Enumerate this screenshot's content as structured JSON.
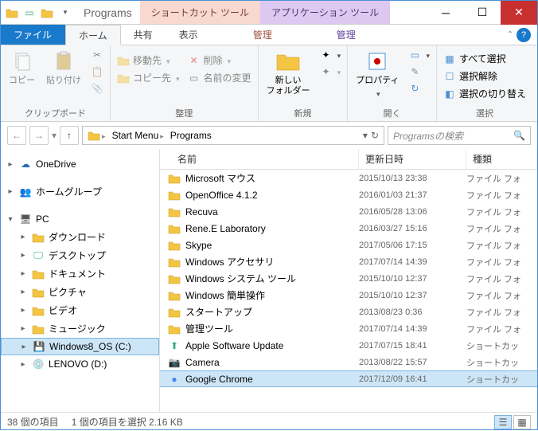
{
  "window": {
    "title": "Programs",
    "context_tabs": [
      "ショートカット ツール",
      "アプリケーション ツール"
    ]
  },
  "tabs": {
    "file": "ファイル",
    "home": "ホーム",
    "share": "共有",
    "view": "表示",
    "ctx1": "管理",
    "ctx2": "管理"
  },
  "ribbon": {
    "clipboard": {
      "label": "クリップボード",
      "copy": "コピー",
      "paste": "貼り付け"
    },
    "organize": {
      "label": "整理",
      "move_to": "移動先",
      "copy_to": "コピー先",
      "delete": "削除",
      "rename": "名前の変更"
    },
    "new": {
      "label": "新規",
      "new_folder": "新しい\nフォルダー"
    },
    "open": {
      "label": "開く",
      "properties": "プロパティ"
    },
    "select": {
      "label": "選択",
      "select_all": "すべて選択",
      "select_none": "選択解除",
      "invert": "選択の切り替え"
    }
  },
  "breadcrumb": {
    "items": [
      "Start Menu",
      "Programs"
    ]
  },
  "search": {
    "placeholder": "Programsの検索"
  },
  "sidebar": {
    "onedrive": "OneDrive",
    "homegroup": "ホームグループ",
    "pc": "PC",
    "downloads": "ダウンロード",
    "desktop": "デスクトップ",
    "documents": "ドキュメント",
    "pictures": "ピクチャ",
    "videos": "ビデオ",
    "music": "ミュージック",
    "drive_c": "Windows8_OS (C:)",
    "drive_d": "LENOVO (D:)"
  },
  "columns": {
    "name": "名前",
    "date": "更新日時",
    "type": "種類"
  },
  "files": [
    {
      "name": "Microsoft マウス",
      "date": "2015/10/13 23:38",
      "type": "ファイル フォ",
      "icon": "folder"
    },
    {
      "name": "OpenOffice 4.1.2",
      "date": "2016/01/03 21:37",
      "type": "ファイル フォ",
      "icon": "folder"
    },
    {
      "name": "Recuva",
      "date": "2016/05/28 13:06",
      "type": "ファイル フォ",
      "icon": "folder"
    },
    {
      "name": "Rene.E Laboratory",
      "date": "2016/03/27 15:16",
      "type": "ファイル フォ",
      "icon": "folder"
    },
    {
      "name": "Skype",
      "date": "2017/05/06 17:15",
      "type": "ファイル フォ",
      "icon": "folder"
    },
    {
      "name": "Windows アクセサリ",
      "date": "2017/07/14 14:39",
      "type": "ファイル フォ",
      "icon": "folder"
    },
    {
      "name": "Windows システム ツール",
      "date": "2015/10/10 12:37",
      "type": "ファイル フォ",
      "icon": "folder"
    },
    {
      "name": "Windows 簡単操作",
      "date": "2015/10/10 12:37",
      "type": "ファイル フォ",
      "icon": "folder"
    },
    {
      "name": "スタートアップ",
      "date": "2013/08/23 0:36",
      "type": "ファイル フォ",
      "icon": "folder"
    },
    {
      "name": "管理ツール",
      "date": "2017/07/14 14:39",
      "type": "ファイル フォ",
      "icon": "folder"
    },
    {
      "name": "Apple Software Update",
      "date": "2017/07/15 18:41",
      "type": "ショートカッ",
      "icon": "app-apple"
    },
    {
      "name": "Camera",
      "date": "2013/08/22 15:57",
      "type": "ショートカッ",
      "icon": "app-camera"
    },
    {
      "name": "Google Chrome",
      "date": "2017/12/09 16:41",
      "type": "ショートカッ",
      "icon": "app-chrome",
      "selected": true
    }
  ],
  "status": {
    "count": "38 個の項目",
    "selection": "1 個の項目を選択 2.16 KB"
  }
}
